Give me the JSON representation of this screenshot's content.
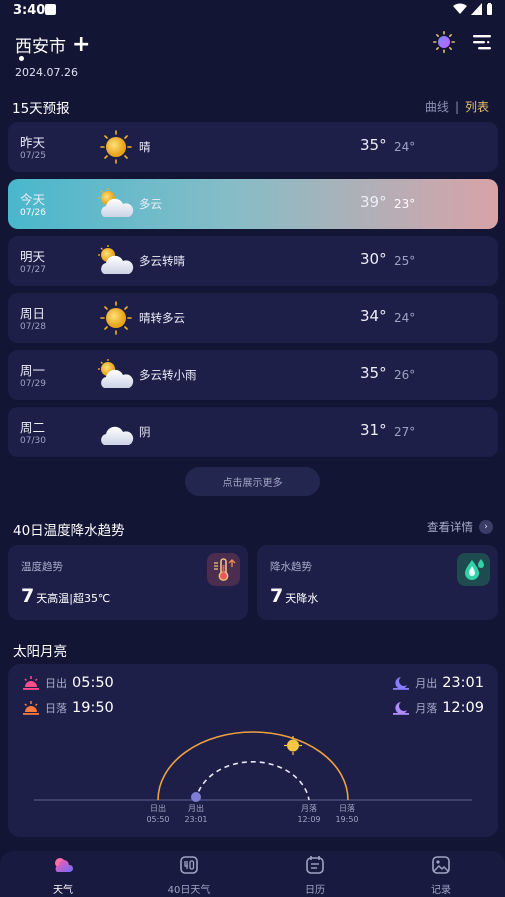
{
  "status": {
    "time": "3:40"
  },
  "header": {
    "city": "西安市",
    "add_icon": "+",
    "date": "2024.07.26"
  },
  "forecast": {
    "title": "15天预报",
    "toggle_curve": "曲线",
    "toggle_sep": "|",
    "toggle_list": "列表",
    "rows": [
      {
        "day": "昨天",
        "date": "07/25",
        "icon": "sunny-icon",
        "cond": "晴",
        "hi": "35°",
        "lo": "24°"
      },
      {
        "day": "今天",
        "date": "07/26",
        "icon": "partly-cloudy-icon",
        "cond": "多云",
        "hi": "39°",
        "lo": "23°"
      },
      {
        "day": "明天",
        "date": "07/27",
        "icon": "partly-cloudy-icon",
        "cond": "多云转晴",
        "hi": "30°",
        "lo": "25°"
      },
      {
        "day": "周日",
        "date": "07/28",
        "icon": "sunny-icon",
        "cond": "晴转多云",
        "hi": "34°",
        "lo": "24°"
      },
      {
        "day": "周一",
        "date": "07/29",
        "icon": "partly-cloudy-icon",
        "cond": "多云转小雨",
        "hi": "35°",
        "lo": "26°"
      },
      {
        "day": "周二",
        "date": "07/30",
        "icon": "cloudy-icon",
        "cond": "阴",
        "hi": "31°",
        "lo": "27°"
      }
    ],
    "more": "点击展示更多"
  },
  "trend": {
    "title": "40日温度降水趋势",
    "detail": "查看详情",
    "temp": {
      "title": "温度趋势",
      "num": "7",
      "text": "天高温|超35℃"
    },
    "rain": {
      "title": "降水趋势",
      "num": "7",
      "text": "天降水"
    }
  },
  "sunmoon": {
    "title": "太阳月亮",
    "sunrise_label": "日出",
    "sunrise": "05:50",
    "sunset_label": "日落",
    "sunset": "19:50",
    "moonrise_label": "月出",
    "moonrise": "23:01",
    "moonset_label": "月落",
    "moonset": "12:09",
    "axis": [
      {
        "label": "日出",
        "time": "05:50"
      },
      {
        "label": "月出",
        "time": "23:01"
      },
      {
        "label": "月落",
        "time": "12:09"
      },
      {
        "label": "日落",
        "time": "19:50"
      }
    ]
  },
  "nav": [
    {
      "label": "天气",
      "icon": "weather-tab-icon"
    },
    {
      "label": "40日天气",
      "icon": "forty-day-tab-icon"
    },
    {
      "label": "日历",
      "icon": "calendar-tab-icon"
    },
    {
      "label": "记录",
      "icon": "gallery-tab-icon"
    }
  ],
  "colors": {
    "background": "#131535",
    "card": "#1d1f48",
    "accent": "#e8c06a",
    "sun_arc": "#f0a040"
  }
}
